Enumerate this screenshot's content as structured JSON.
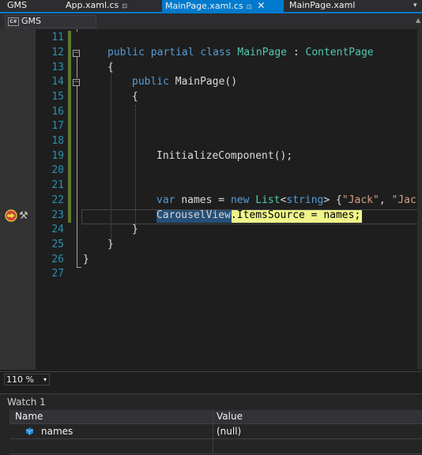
{
  "tabs": {
    "project": "GMS",
    "app_xaml_cs": "App.xaml.cs",
    "main_page_xaml_cs": "MainPage.xaml.cs",
    "main_page_xaml": "MainPage.xaml",
    "pin_glyph": "⊡",
    "close_glyph": "✕",
    "overflow_glyph": "▾"
  },
  "navbar": {
    "project_label": "GMS",
    "cs_badge": "C#"
  },
  "editor": {
    "line_numbers": [
      "11",
      "12",
      "13",
      "14",
      "15",
      "16",
      "17",
      "18",
      "19",
      "20",
      "21",
      "22",
      "23",
      "24",
      "25",
      "26",
      "27"
    ],
    "code": {
      "l12_public": "public",
      "l12_partial": "partial",
      "l12_class": "class",
      "l12_name": "MainPage",
      "l12_colon": ":",
      "l12_base": "ContentPage",
      "l13": "{",
      "l14_public": "public",
      "l14_rest": "MainPage()",
      "l15": "{",
      "l19": "InitializeComponent();",
      "l22_var": "var",
      "l22_names": "names =",
      "l22_new": "new",
      "l22_list": "List",
      "l22_lt": "<",
      "l22_string": "string",
      "l22_gt": "> {",
      "l22_jack": "\"Jack\"",
      "l22_comma": ",",
      "l22_jack2": "\"Jack",
      "l23_carousel": "CarouselView",
      "l23_rest": ".ItemsSource = names;",
      "l24": "}",
      "l25": "}",
      "l26": "}"
    }
  },
  "zoom": {
    "value": "110 %",
    "chevron": "▾"
  },
  "watch": {
    "title": "Watch 1",
    "headers": {
      "name": "Name",
      "value": "Value"
    },
    "rows": [
      {
        "name": "names",
        "value": "(null)"
      }
    ]
  }
}
